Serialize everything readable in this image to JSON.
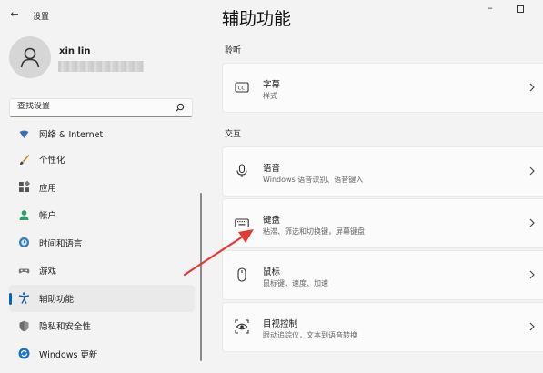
{
  "window": {
    "back_glyph": "←",
    "app_title": "设置",
    "minimize_glyph": "–"
  },
  "profile": {
    "name": "xin lin"
  },
  "search": {
    "placeholder": "查找设置"
  },
  "sidebar": {
    "items": [
      {
        "label": "网络 & Internet",
        "icon": "network-icon"
      },
      {
        "label": "个性化",
        "icon": "brush-icon"
      },
      {
        "label": "应用",
        "icon": "apps-icon"
      },
      {
        "label": "帐户",
        "icon": "account-icon"
      },
      {
        "label": "时间和语言",
        "icon": "globe-clock-icon"
      },
      {
        "label": "游戏",
        "icon": "gamepad-icon"
      },
      {
        "label": "辅助功能",
        "icon": "accessibility-icon",
        "active": true
      },
      {
        "label": "隐私和安全性",
        "icon": "shield-icon"
      },
      {
        "label": "Windows 更新",
        "icon": "update-icon"
      }
    ]
  },
  "main": {
    "title": "辅助功能",
    "sections": [
      {
        "heading": "聆听",
        "cards": [
          {
            "title": "字幕",
            "subtitle": "样式",
            "icon": "captions-icon"
          }
        ]
      },
      {
        "heading": "交互",
        "cards": [
          {
            "title": "语音",
            "subtitle": "Windows 语音识别、语音键入",
            "icon": "microphone-icon"
          },
          {
            "title": "键盘",
            "subtitle": "粘滞、筛选和切换键，屏幕键盘",
            "icon": "keyboard-icon"
          },
          {
            "title": "鼠标",
            "subtitle": "鼠标键、速度、加速",
            "icon": "mouse-icon"
          },
          {
            "title": "目视控制",
            "subtitle": "眼动追踪仪，文本到语音转换",
            "icon": "eye-control-icon"
          }
        ]
      }
    ]
  },
  "colors": {
    "accent": "#0067c0",
    "annotation": "#e53935",
    "background": "#f3f3f3",
    "card": "#fbfbfb"
  }
}
